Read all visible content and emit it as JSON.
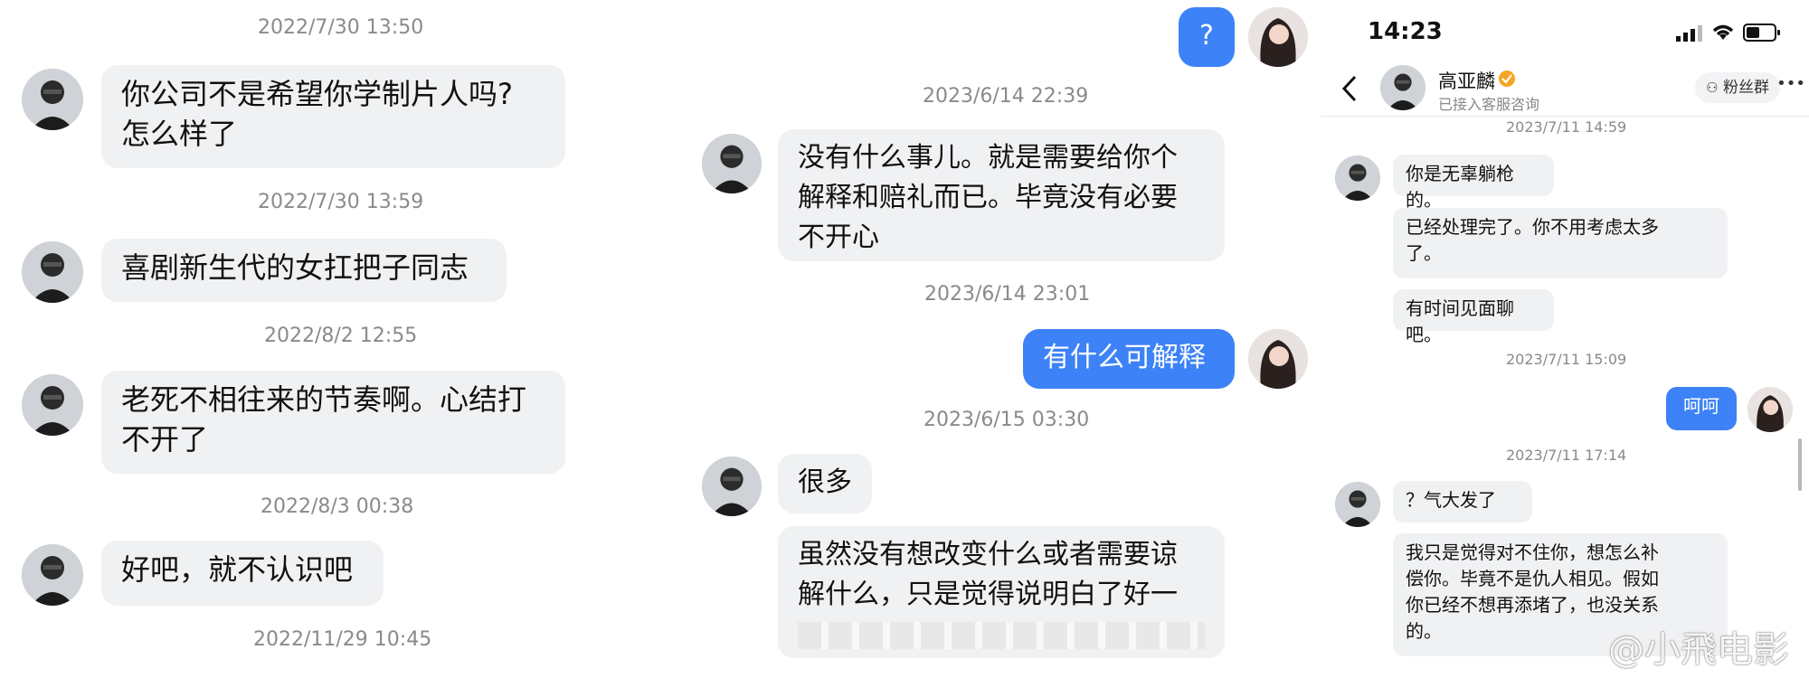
{
  "panel1": {
    "timestamps": [
      "2022/7/30 13:50",
      "2022/7/30 13:59",
      "2022/8/2 12:55",
      "2022/8/3 00:38",
      "2022/11/29 10:45"
    ],
    "messages": [
      [
        "你公司不是希望你学制片人吗?",
        "怎么样了"
      ],
      [
        "喜剧新生代的女扛把子同志"
      ],
      [
        "老死不相往来的节奏啊。心结打",
        "不开了"
      ],
      [
        "好吧，就不认识吧"
      ]
    ]
  },
  "panel2": {
    "top_reply": "?",
    "timestamps": [
      "2023/6/14 22:39",
      "2023/6/14 23:01",
      "2023/6/15 03:30"
    ],
    "msg1": [
      "没有什么事儿。就是需要给你个",
      "解释和赔礼而已。毕竟没有必要",
      "不开心"
    ],
    "reply": "有什么可解释",
    "msg2": "很多",
    "msg3": [
      "虽然没有想改变什么或者需要谅",
      "解什么，只是觉得说明白了好一"
    ]
  },
  "panel3": {
    "status_time": "14:23",
    "contact_name": "高亚麟",
    "contact_subtitle": "已接入客服咨询",
    "fan_group_label": "粉丝群",
    "more_label": "•••",
    "timestamps": [
      "2023/7/11 14:59",
      "2023/7/11 15:09",
      "2023/7/11 17:14"
    ],
    "msg1": "你是无辜躺枪的。",
    "msg2": [
      "已经处理完了。你不用考虑太多",
      "了。"
    ],
    "msg3": "有时间见面聊吧。",
    "reply": "呵呵",
    "msg4": "？气大发了",
    "msg5": [
      "我只是觉得对不住你，想怎么补",
      "偿你。毕竟不是仇人相见。假如",
      "你已经不想再添堵了，也没关系",
      "的。"
    ]
  },
  "watermark": "@小飛电影",
  "colors": {
    "blue_bubble": "#3d82f6",
    "grey_bubble": "#f0f1f3",
    "timestamp": "#8a8a8e"
  }
}
